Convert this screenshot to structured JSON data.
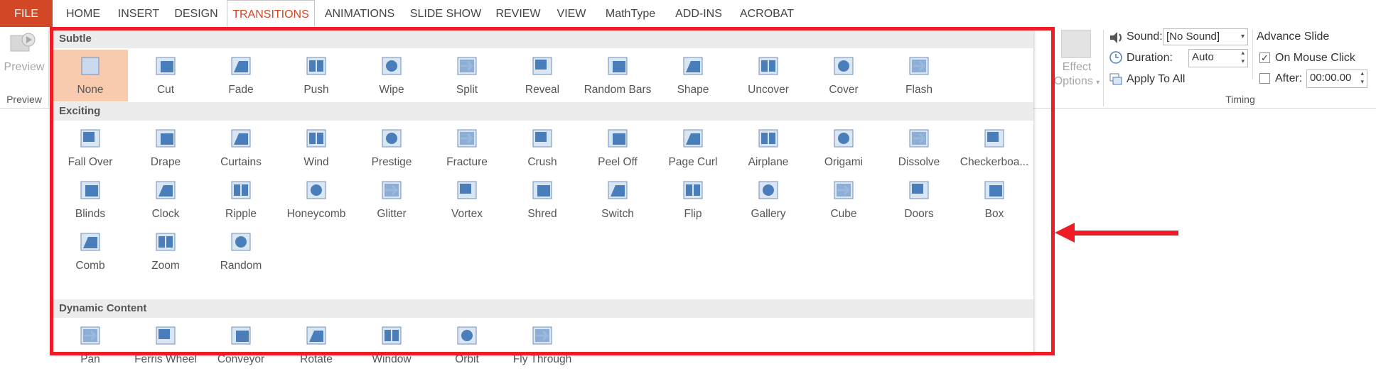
{
  "tabs": [
    {
      "label": "FILE",
      "kind": "file"
    },
    {
      "label": "HOME"
    },
    {
      "label": "INSERT"
    },
    {
      "label": "DESIGN"
    },
    {
      "label": "TRANSITIONS",
      "active": true
    },
    {
      "label": "ANIMATIONS"
    },
    {
      "label": "SLIDE SHOW"
    },
    {
      "label": "REVIEW"
    },
    {
      "label": "VIEW"
    },
    {
      "label": "MathType"
    },
    {
      "label": "ADD-INS"
    },
    {
      "label": "ACROBAT"
    }
  ],
  "preview": {
    "button_label": "Preview",
    "group_label": "Preview"
  },
  "effect_options": {
    "line1": "Effect",
    "line2": "Options"
  },
  "timing": {
    "sound_label": "Sound:",
    "sound_value": "[No Sound]",
    "duration_label": "Duration:",
    "duration_value": "Auto",
    "apply_all_label": "Apply To All",
    "advance_title": "Advance Slide",
    "on_mouse_click_label": "On Mouse Click",
    "on_mouse_click_checked": true,
    "after_label": "After:",
    "after_value": "00:00.00",
    "after_checked": false,
    "group_label": "Timing"
  },
  "gallery": {
    "sections": [
      {
        "title": "Subtle",
        "items": [
          {
            "label": "None",
            "icon": "none-icon",
            "selected": true
          },
          {
            "label": "Cut",
            "icon": "cut-icon"
          },
          {
            "label": "Fade",
            "icon": "fade-icon"
          },
          {
            "label": "Push",
            "icon": "push-icon"
          },
          {
            "label": "Wipe",
            "icon": "wipe-icon"
          },
          {
            "label": "Split",
            "icon": "split-icon"
          },
          {
            "label": "Reveal",
            "icon": "reveal-icon"
          },
          {
            "label": "Random Bars",
            "icon": "random-bars-icon"
          },
          {
            "label": "Shape",
            "icon": "shape-icon"
          },
          {
            "label": "Uncover",
            "icon": "uncover-icon"
          },
          {
            "label": "Cover",
            "icon": "cover-icon"
          },
          {
            "label": "Flash",
            "icon": "flash-icon"
          }
        ]
      },
      {
        "title": "Exciting",
        "items": [
          {
            "label": "Fall Over",
            "icon": "fall-over-icon"
          },
          {
            "label": "Drape",
            "icon": "drape-icon"
          },
          {
            "label": "Curtains",
            "icon": "curtains-icon"
          },
          {
            "label": "Wind",
            "icon": "wind-icon"
          },
          {
            "label": "Prestige",
            "icon": "prestige-icon"
          },
          {
            "label": "Fracture",
            "icon": "fracture-icon"
          },
          {
            "label": "Crush",
            "icon": "crush-icon"
          },
          {
            "label": "Peel Off",
            "icon": "peel-off-icon"
          },
          {
            "label": "Page Curl",
            "icon": "page-curl-icon"
          },
          {
            "label": "Airplane",
            "icon": "airplane-icon"
          },
          {
            "label": "Origami",
            "icon": "origami-icon"
          },
          {
            "label": "Dissolve",
            "icon": "dissolve-icon"
          },
          {
            "label": "Checkerboa...",
            "icon": "checkerboard-icon"
          },
          {
            "label": "Blinds",
            "icon": "blinds-icon"
          },
          {
            "label": "Clock",
            "icon": "clock-icon"
          },
          {
            "label": "Ripple",
            "icon": "ripple-icon"
          },
          {
            "label": "Honeycomb",
            "icon": "honeycomb-icon"
          },
          {
            "label": "Glitter",
            "icon": "glitter-icon"
          },
          {
            "label": "Vortex",
            "icon": "vortex-icon"
          },
          {
            "label": "Shred",
            "icon": "shred-icon"
          },
          {
            "label": "Switch",
            "icon": "switch-icon"
          },
          {
            "label": "Flip",
            "icon": "flip-icon"
          },
          {
            "label": "Gallery",
            "icon": "gallery-icon"
          },
          {
            "label": "Cube",
            "icon": "cube-icon"
          },
          {
            "label": "Doors",
            "icon": "doors-icon"
          },
          {
            "label": "Box",
            "icon": "box-icon"
          },
          {
            "label": "Comb",
            "icon": "comb-icon"
          },
          {
            "label": "Zoom",
            "icon": "zoom-icon"
          },
          {
            "label": "Random",
            "icon": "random-icon"
          }
        ]
      },
      {
        "title": "Dynamic Content",
        "items": [
          {
            "label": "Pan",
            "icon": "pan-icon"
          },
          {
            "label": "Ferris Wheel",
            "icon": "ferris-wheel-icon"
          },
          {
            "label": "Conveyor",
            "icon": "conveyor-icon"
          },
          {
            "label": "Rotate",
            "icon": "rotate-icon"
          },
          {
            "label": "Window",
            "icon": "window-icon"
          },
          {
            "label": "Orbit",
            "icon": "orbit-icon"
          },
          {
            "label": "Fly Through",
            "icon": "fly-through-icon"
          }
        ]
      }
    ]
  },
  "colors": {
    "accent": "#d24726",
    "highlight": "#ee1c24",
    "selected_bg": "#f9cbae",
    "icon_blue": "#4a7ebb"
  }
}
